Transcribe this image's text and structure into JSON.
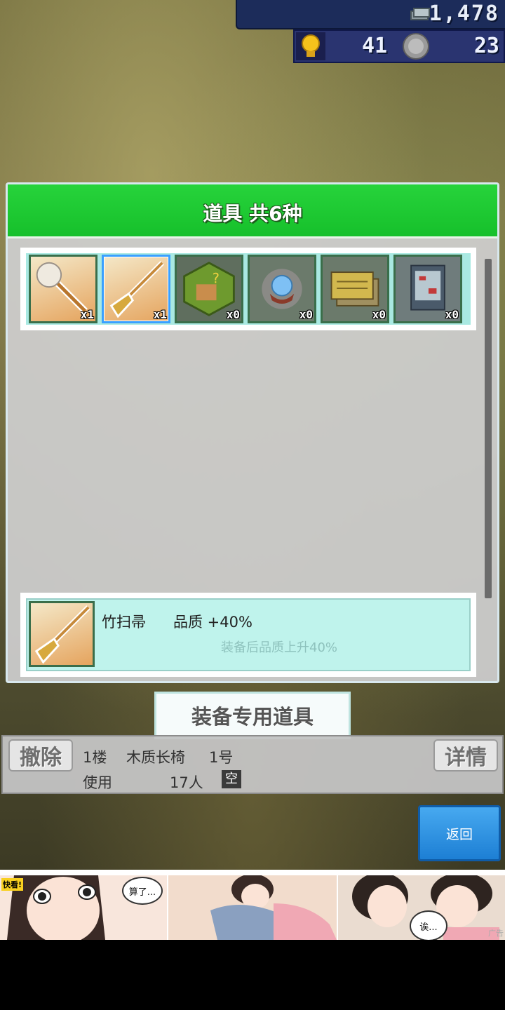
{
  "top_bar": {
    "money": "1,478",
    "bulbs": "41",
    "medals": "23"
  },
  "dialog": {
    "title": "道具 共6种",
    "items": [
      {
        "name": "duster",
        "qty": "x1",
        "selected": false
      },
      {
        "name": "bamboo-broom",
        "qty": "x1",
        "selected": true
      },
      {
        "name": "mystery-building",
        "qty": "x0",
        "selected": false
      },
      {
        "name": "crystal-ball",
        "qty": "x0",
        "selected": false
      },
      {
        "name": "ticket-stack",
        "qty": "x0",
        "selected": false
      },
      {
        "name": "book",
        "qty": "x0",
        "selected": false
      }
    ],
    "detail": {
      "name": "竹扫帚",
      "stat": "品质 +40%",
      "description": "装备后品质上升40%"
    }
  },
  "equip_button": "装备专用道具",
  "info_bar": {
    "remove_label": "撤除",
    "detail_label": "详情",
    "floor": "1楼",
    "facility": "木质长椅",
    "number": "1号",
    "usage_label": "使用",
    "usage_count": "17人",
    "status": "空"
  },
  "back_button": "返回",
  "ad": {
    "tag": "快看!",
    "bubble1": "算了...",
    "bubble2": "诶...",
    "ad_mark": "广告"
  }
}
